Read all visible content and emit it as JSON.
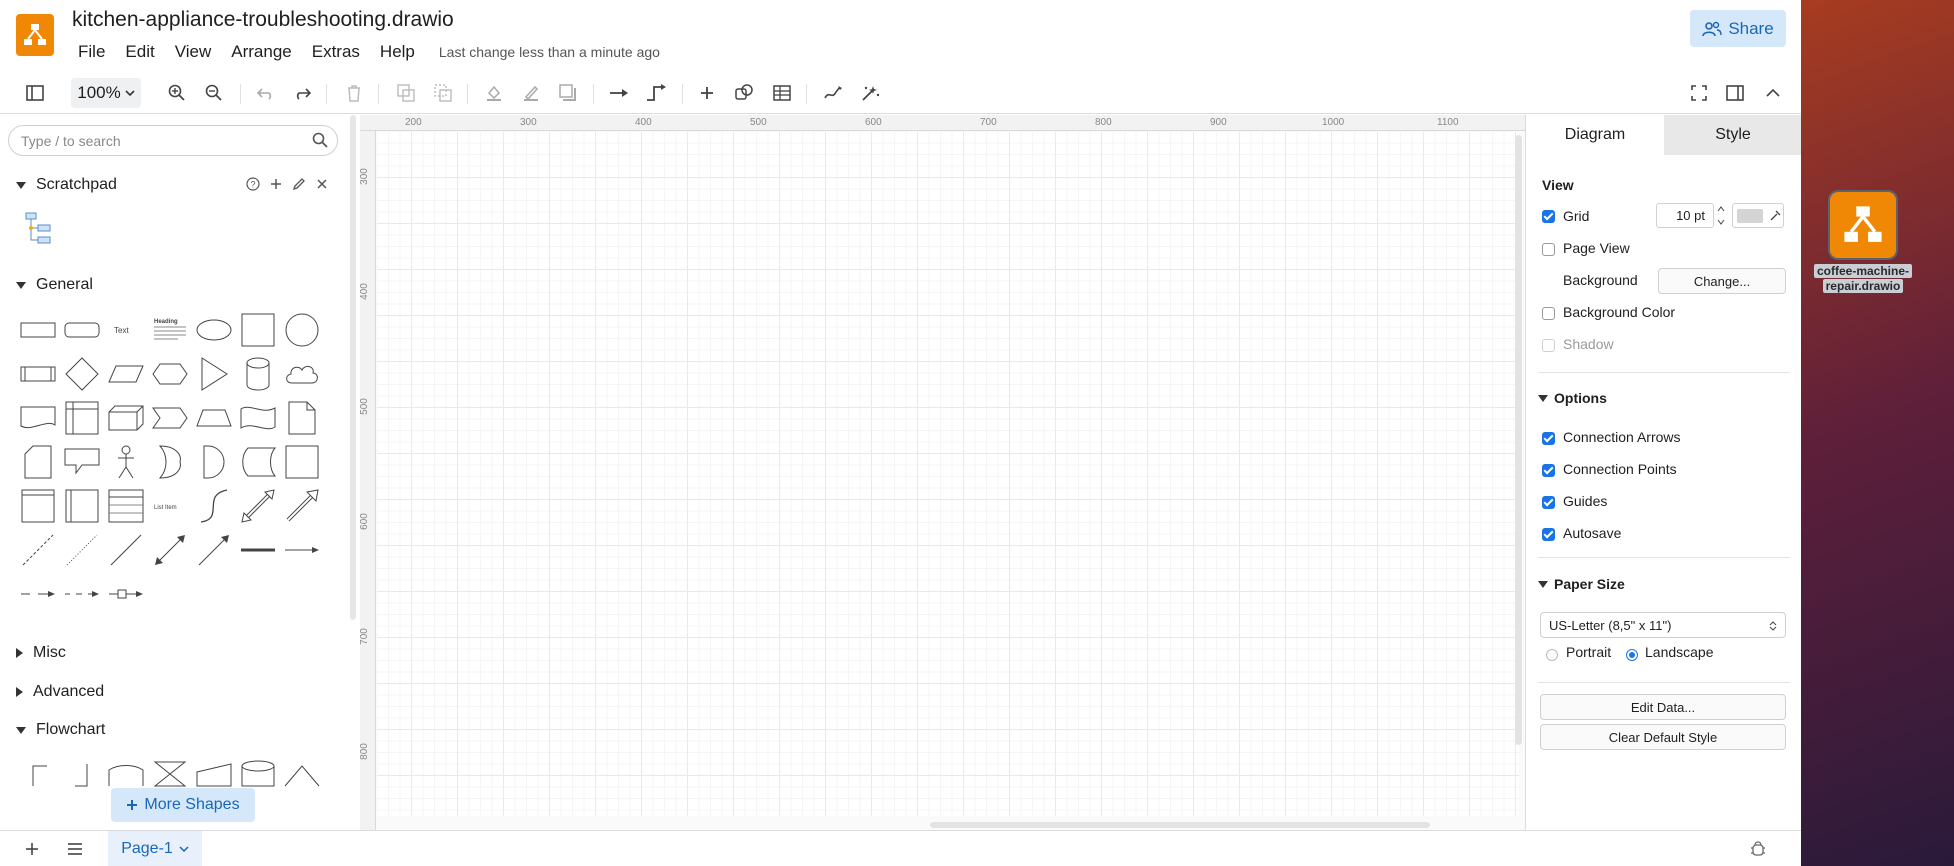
{
  "app": {
    "document_title": "kitchen-appliance-troubleshooting.drawio",
    "menus": [
      "File",
      "Edit",
      "View",
      "Arrange",
      "Extras",
      "Help"
    ],
    "last_change": "Last change less than a minute ago",
    "share_label": "Share",
    "accent_color": "#1a73e8",
    "logo_color": "#f08705"
  },
  "toolbar": {
    "zoom": "100%",
    "icons": [
      "sidebar-toggle-icon",
      "zoom-in-icon",
      "zoom-out-icon",
      "undo-icon",
      "redo-icon",
      "delete-icon",
      "to-front-icon",
      "to-back-icon",
      "fill-color-icon",
      "line-color-icon",
      "shadow-icon",
      "connection-icon",
      "waypoints-icon",
      "insert-icon",
      "shapes-icon",
      "table-icon",
      "freehand-icon",
      "ai-generate-icon",
      "fullscreen-icon",
      "format-panel-icon",
      "collapse-icon"
    ]
  },
  "sidebar": {
    "search_placeholder": "Type / to search",
    "scratchpad_label": "Scratchpad",
    "general_label": "General",
    "misc_label": "Misc",
    "advanced_label": "Advanced",
    "flowchart_label": "Flowchart",
    "more_shapes_label": "More Shapes"
  },
  "canvas": {
    "ruler_x": [
      "200",
      "300",
      "400",
      "500",
      "600",
      "700",
      "800",
      "900",
      "1000",
      "1100"
    ],
    "ruler_y": [
      "300",
      "400",
      "500",
      "600",
      "700",
      "800"
    ]
  },
  "panel": {
    "tabs": [
      "Diagram",
      "Style"
    ],
    "view_label": "View",
    "grid_label": "Grid",
    "grid_size": "10 pt",
    "page_view_label": "Page View",
    "background_label": "Background",
    "change_label": "Change...",
    "background_color_label": "Background Color",
    "shadow_label": "Shadow",
    "options_label": "Options",
    "connection_arrows_label": "Connection Arrows",
    "connection_points_label": "Connection Points",
    "guides_label": "Guides",
    "autosave_label": "Autosave",
    "paper_size_label": "Paper Size",
    "paper_size_value": "US-Letter (8,5\" x 11\")",
    "portrait_label": "Portrait",
    "landscape_label": "Landscape",
    "edit_data_label": "Edit Data...",
    "clear_default_style_label": "Clear Default Style"
  },
  "bottombar": {
    "page_tab": "Page-1"
  },
  "desktop": {
    "file_label_line1": "coffee-machine-",
    "file_label_line2": "repair.drawio"
  }
}
